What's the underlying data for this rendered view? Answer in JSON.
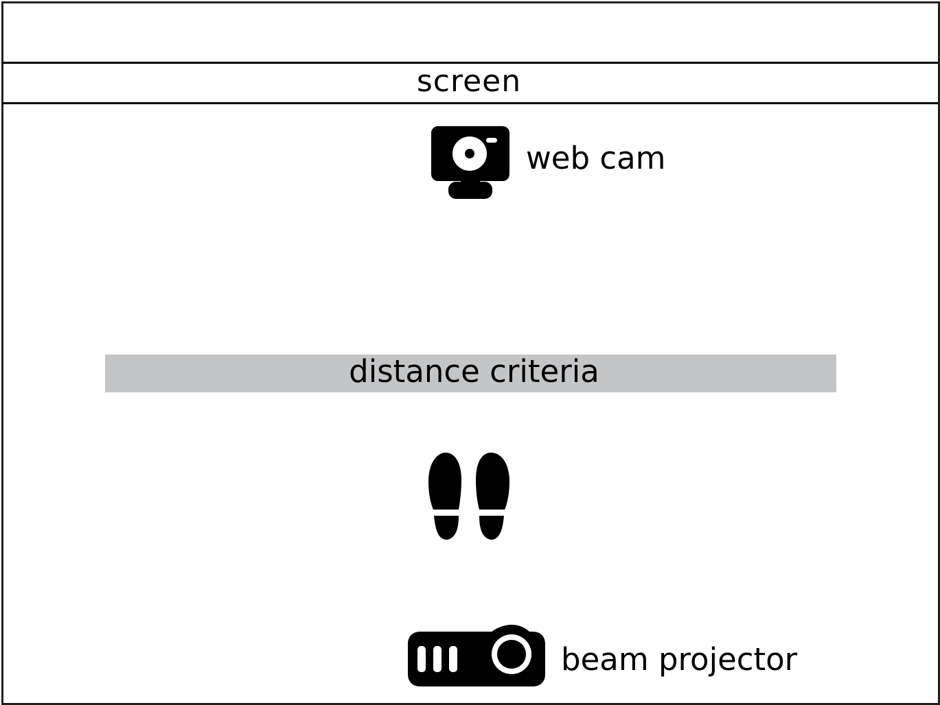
{
  "diagram": {
    "screen": {
      "label": "screen"
    },
    "webcam": {
      "label": "web cam",
      "icon": "webcam-icon"
    },
    "distance": {
      "label": "distance criteria",
      "band_color": "#c4c5c7"
    },
    "standing_position": {
      "icon": "footprints-icon"
    },
    "projector": {
      "label": "beam projector",
      "icon": "projector-icon"
    },
    "colors": {
      "ink": "#000000",
      "frame": "#231f20",
      "background": "#ffffff"
    }
  }
}
